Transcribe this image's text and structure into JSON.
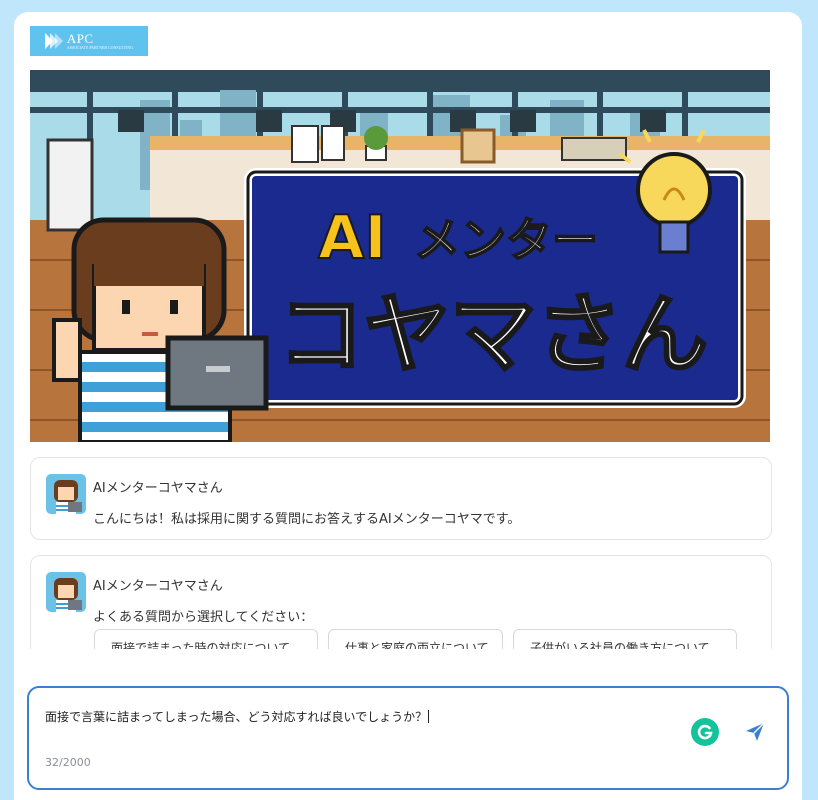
{
  "brand": {
    "logo_text": "APC",
    "logo_subtext": "ASSOCIATE PARTNER CONSULTING",
    "accent": "#5fc3ee"
  },
  "banner": {
    "line1_ai": "AI",
    "line1_rest": "メンター",
    "line2": "コヤマさん"
  },
  "messages": [
    {
      "sender": "AIメンターコヤマさん",
      "text": "こんにちは！私は採用に関する質問にお答えするAIメンターコヤマです。"
    },
    {
      "sender": "AIメンターコヤマさん",
      "text": "よくある質問から選択してください："
    }
  ],
  "faq_chips": [
    "面接で詰まった時の対応について",
    "仕事と家庭の両立について",
    "子供がいる社員の働き方について"
  ],
  "composer": {
    "value": "面接で言葉に詰まってしまった場合、どう対応すれば良いでしょうか？",
    "counter": "32/2000",
    "border_color": "#3b7fd0"
  },
  "icons": {
    "grammarly": "grammarly-icon",
    "send": "send-icon"
  }
}
